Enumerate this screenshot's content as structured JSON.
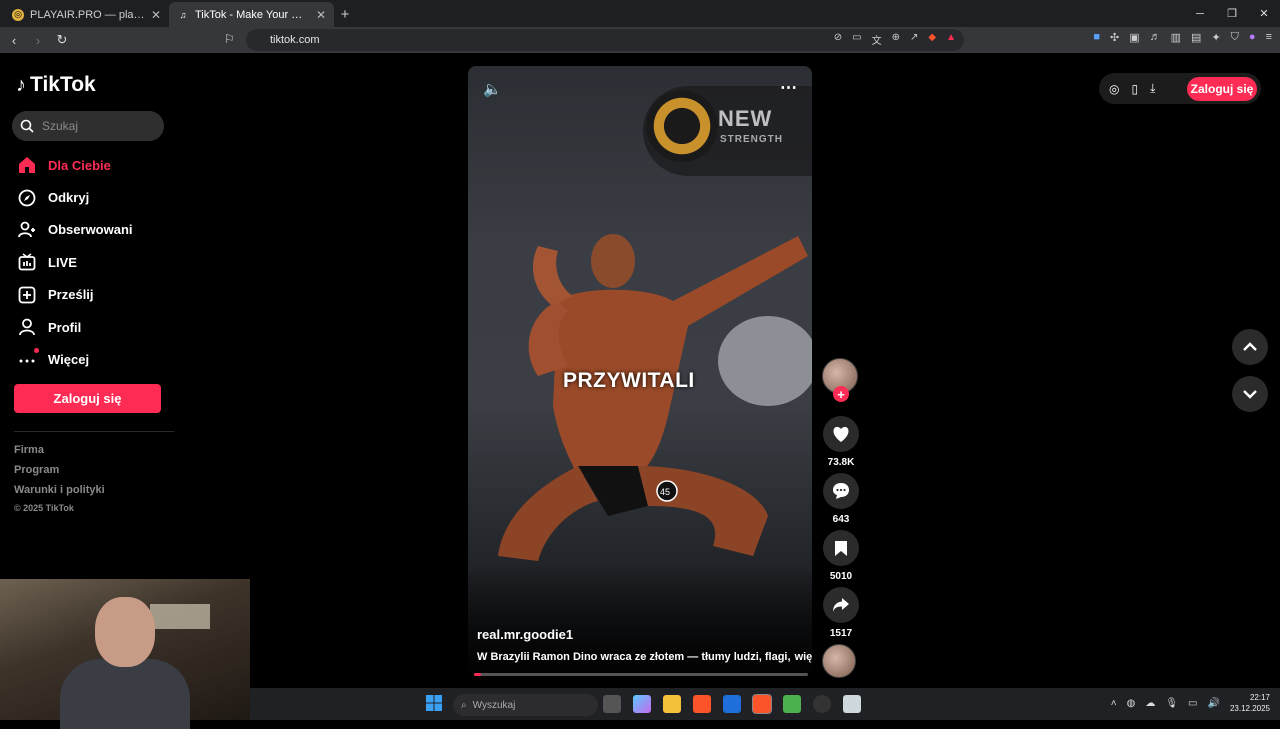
{
  "browser": {
    "tabs": [
      {
        "title": "PLAYAIR.PRO — platforma, która łącz",
        "active": false
      },
      {
        "title": "TikTok - Make Your Day",
        "active": true
      }
    ],
    "new_tab": "+",
    "url": "tiktok.com"
  },
  "sidebar": {
    "logo": "TikTok",
    "search_placeholder": "Szukaj",
    "items": [
      {
        "label": "Dla Ciebie",
        "icon": "home-icon",
        "active": true
      },
      {
        "label": "Odkryj",
        "icon": "compass-icon",
        "active": false
      },
      {
        "label": "Obserwowani",
        "icon": "following-icon",
        "active": false
      },
      {
        "label": "LIVE",
        "icon": "live-icon",
        "active": false
      },
      {
        "label": "Prześlij",
        "icon": "upload-icon",
        "active": false
      },
      {
        "label": "Profil",
        "icon": "profile-icon",
        "active": false
      },
      {
        "label": "Więcej",
        "icon": "more-icon",
        "active": false
      }
    ],
    "login": "Zaloguj się",
    "footer": [
      "Firma",
      "Program",
      "Warunki i polityki"
    ],
    "copyright": "© 2025 TikTok"
  },
  "video": {
    "overlay_text": "PRZYWITALI",
    "author": "real.mr.goodie1",
    "caption": "W Brazylii Ramon Dino wraca ze złotem — tłumy ludzi, flagi,",
    "more": "więcej",
    "progress": 0.02,
    "sign_text": "NEW",
    "sign_subtext": "STRENGTH",
    "pose_number": "45"
  },
  "actions": {
    "likes": "73.8K",
    "comments": "643",
    "saves": "5010",
    "shares": "1517"
  },
  "header": {
    "login": "Zaloguj się"
  },
  "taskbar": {
    "search": "Wyszukaj",
    "time": "22:17",
    "date": "23.12.2025"
  },
  "colors": {
    "accent": "#fe2c55",
    "background": "#000000"
  }
}
